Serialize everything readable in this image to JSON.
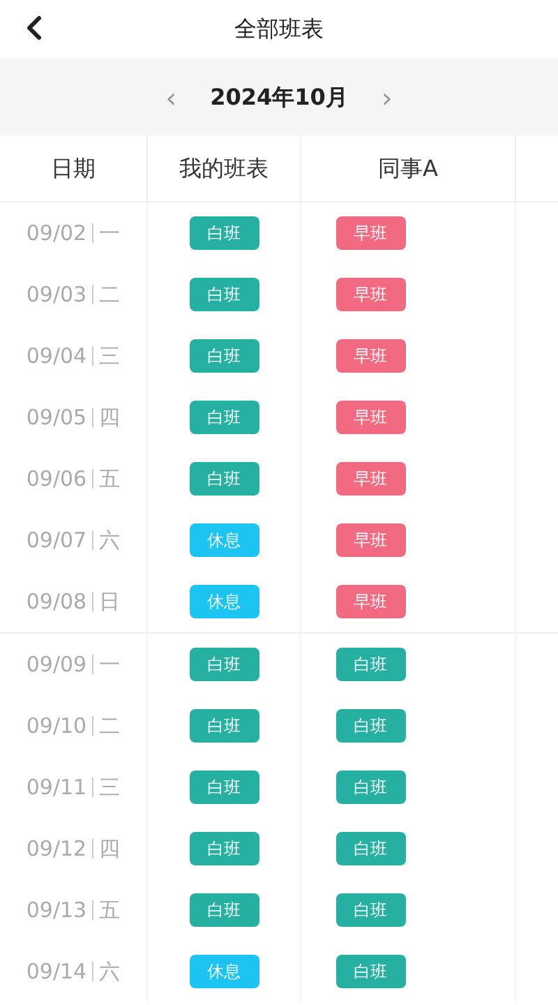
{
  "header": {
    "title": "全部班表"
  },
  "month_bar": {
    "prev": "‹",
    "label": "2024年10月",
    "next": "›"
  },
  "columns": [
    "日期",
    "我的班表",
    "同事A"
  ],
  "weeks": [
    {
      "rows": [
        {
          "date": "09/02",
          "weekday": "一",
          "shifts": [
            {
              "label": "白班",
              "kind": "day"
            },
            {
              "label": "早班",
              "kind": "early"
            }
          ]
        },
        {
          "date": "09/03",
          "weekday": "二",
          "shifts": [
            {
              "label": "白班",
              "kind": "day"
            },
            {
              "label": "早班",
              "kind": "early"
            }
          ]
        },
        {
          "date": "09/04",
          "weekday": "三",
          "shifts": [
            {
              "label": "白班",
              "kind": "day"
            },
            {
              "label": "早班",
              "kind": "early"
            }
          ]
        },
        {
          "date": "09/05",
          "weekday": "四",
          "shifts": [
            {
              "label": "白班",
              "kind": "day"
            },
            {
              "label": "早班",
              "kind": "early"
            }
          ]
        },
        {
          "date": "09/06",
          "weekday": "五",
          "shifts": [
            {
              "label": "白班",
              "kind": "day"
            },
            {
              "label": "早班",
              "kind": "early"
            }
          ]
        },
        {
          "date": "09/07",
          "weekday": "六",
          "shifts": [
            {
              "label": "休息",
              "kind": "rest"
            },
            {
              "label": "早班",
              "kind": "early"
            }
          ]
        },
        {
          "date": "09/08",
          "weekday": "日",
          "shifts": [
            {
              "label": "休息",
              "kind": "rest"
            },
            {
              "label": "早班",
              "kind": "early"
            }
          ]
        }
      ]
    },
    {
      "rows": [
        {
          "date": "09/09",
          "weekday": "一",
          "shifts": [
            {
              "label": "白班",
              "kind": "day"
            },
            {
              "label": "白班",
              "kind": "day"
            }
          ]
        },
        {
          "date": "09/10",
          "weekday": "二",
          "shifts": [
            {
              "label": "白班",
              "kind": "day"
            },
            {
              "label": "白班",
              "kind": "day"
            }
          ]
        },
        {
          "date": "09/11",
          "weekday": "三",
          "shifts": [
            {
              "label": "白班",
              "kind": "day"
            },
            {
              "label": "白班",
              "kind": "day"
            }
          ]
        },
        {
          "date": "09/12",
          "weekday": "四",
          "shifts": [
            {
              "label": "白班",
              "kind": "day"
            },
            {
              "label": "白班",
              "kind": "day"
            }
          ]
        },
        {
          "date": "09/13",
          "weekday": "五",
          "shifts": [
            {
              "label": "白班",
              "kind": "day"
            },
            {
              "label": "白班",
              "kind": "day"
            }
          ]
        },
        {
          "date": "09/14",
          "weekday": "六",
          "shifts": [
            {
              "label": "休息",
              "kind": "rest"
            },
            {
              "label": "白班",
              "kind": "day"
            }
          ]
        }
      ]
    }
  ]
}
